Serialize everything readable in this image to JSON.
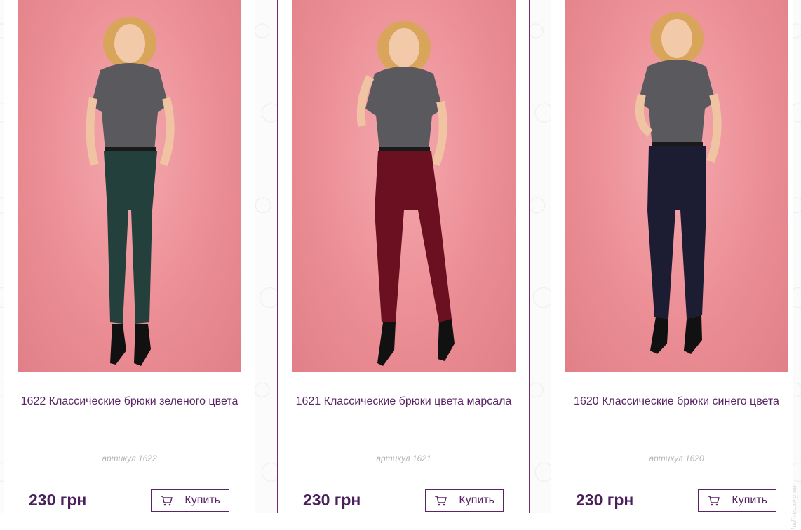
{
  "products": [
    {
      "title": "1622 Классические брюки зеленого цвета",
      "sku": "артикул 1622",
      "price": "230 грн",
      "buy_label": "Купить",
      "pants_color": "#24403c"
    },
    {
      "title": "1621 Классические брюки цвета марсала",
      "sku": "артикул 1621",
      "price": "230 грн",
      "buy_label": "Купить",
      "pants_color": "#6a1020"
    },
    {
      "title": "1620 Классические брюки синего цвета",
      "sku": "артикул 1620",
      "price": "230 грн",
      "buy_label": "Купить",
      "pants_color": "#1c1c33"
    }
  ],
  "colors": {
    "accent": "#5b2466",
    "price": "#4a1f5c",
    "photo_background": "#ec8e95",
    "top": "#5a5a5e",
    "hair": "#d9a55a"
  },
  "icons": {
    "cart": "cart-icon"
  },
  "watermark": "ludivea.org.ua"
}
